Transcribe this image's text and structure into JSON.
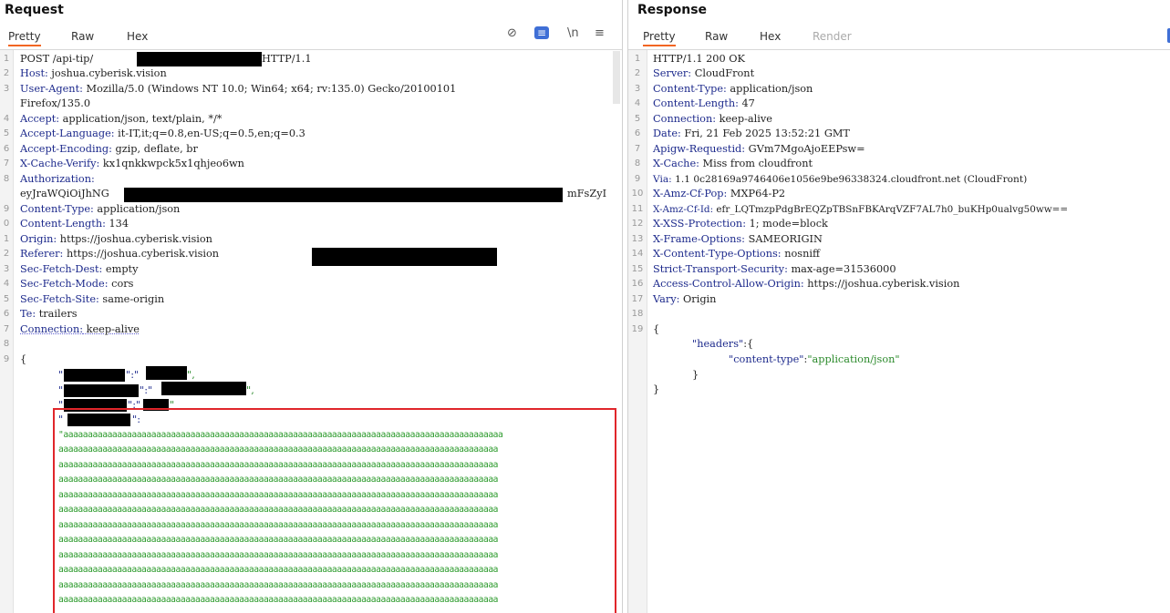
{
  "request": {
    "title": "Request",
    "tabs": [
      "Pretty",
      "Raw",
      "Hex"
    ],
    "toolbar_icons": [
      "eye-slash-icon",
      "wrap-icon",
      "newline-icon",
      "menu-icon"
    ],
    "toolbar_glyphs": [
      "⊘",
      "≡",
      "\\n",
      "≡"
    ],
    "lines": [
      {
        "n": "1",
        "text": "POST /api-tip/",
        "suffix": " HTTP/1.1"
      },
      {
        "n": "2",
        "key": "Host:",
        "value": " joshua.cyberisk.vision"
      },
      {
        "n": "3",
        "key": "User-Agent:",
        "value": " Mozilla/5.0 (Windows NT 10.0; Win64; x64; rv:135.0) Gecko/20100101"
      },
      {
        "n": "",
        "value": "Firefox/135.0"
      },
      {
        "n": "4",
        "key": "Accept:",
        "value": " application/json, text/plain, */*"
      },
      {
        "n": "5",
        "key": "Accept-Language:",
        "value": " it-IT,it;q=0.8,en-US;q=0.5,en;q=0.3"
      },
      {
        "n": "6",
        "key": "Accept-Encoding:",
        "value": " gzip, deflate, br"
      },
      {
        "n": "7",
        "key": "X-Cache-Verify:",
        "value": " kx1qnkkwpck5x1qhjeo6wn"
      },
      {
        "n": "8",
        "key": "Authorization:",
        "value": ""
      },
      {
        "n": "",
        "value": "eyJraWQiOiJhNG",
        "suffix": "mFsZyI"
      },
      {
        "n": "9",
        "key": "Content-Type:",
        "value": " application/json"
      },
      {
        "n": "0",
        "key": "Content-Length:",
        "value": " 134"
      },
      {
        "n": "1",
        "key": "Origin:",
        "value": " https://joshua.cyberisk.vision"
      },
      {
        "n": "2",
        "key": "Referer:",
        "value": " https://joshua.cyberisk.vision"
      },
      {
        "n": "3",
        "key": "Sec-Fetch-Dest:",
        "value": " empty"
      },
      {
        "n": "4",
        "key": "Sec-Fetch-Mode:",
        "value": " cors"
      },
      {
        "n": "5",
        "key": "Sec-Fetch-Site:",
        "value": " same-origin"
      },
      {
        "n": "6",
        "key": "Te:",
        "value": " trailers"
      },
      {
        "n": "7",
        "key": "Connection:",
        "value": " keep-alive"
      },
      {
        "n": "8",
        "value": ""
      },
      {
        "n": "9",
        "value": "{"
      }
    ],
    "body_fragments": {
      "row1_sep": "\":\"",
      "row1_end": "\",",
      "row2_sep": "\":\"",
      "row2_end": "\",",
      "row3_sep": "\":\"",
      "row3_end": "\"",
      "row4_open": "\"",
      "row4_end": "\":",
      "aa_open": "\"",
      "aa_line": "aaaaaaaaaaaaaaaaaaaaaaaaaaaaaaaaaaaaaaaaaaaaaaaaaaaaaaaaaaaaaaaaaaaaaaaaaaaaaaaaaaaaaaaaaa"
    }
  },
  "response": {
    "title": "Response",
    "tabs": [
      "Pretty",
      "Raw",
      "Hex",
      "Render"
    ],
    "lines": [
      {
        "n": "1",
        "value": "HTTP/1.1 200 OK"
      },
      {
        "n": "2",
        "key": "Server:",
        "value": " CloudFront"
      },
      {
        "n": "3",
        "key": "Content-Type:",
        "value": " application/json"
      },
      {
        "n": "4",
        "key": "Content-Length:",
        "value": " 47"
      },
      {
        "n": "5",
        "key": "Connection:",
        "value": " keep-alive"
      },
      {
        "n": "6",
        "key": "Date:",
        "value": " Fri, 21 Feb 2025 13:52:21 GMT"
      },
      {
        "n": "7",
        "key": "Apigw-Requestid:",
        "value": " GVm7MgoAjoEEPsw="
      },
      {
        "n": "8",
        "key": "X-Cache:",
        "value": " Miss from cloudfront"
      },
      {
        "n": "9",
        "key": "Via:",
        "value": " 1.1 0c28169a9746406e1056e9be96338324.cloudfront.net (CloudFront)"
      },
      {
        "n": "10",
        "key": "X-Amz-Cf-Pop:",
        "value": " MXP64-P2"
      },
      {
        "n": "11",
        "key": "X-Amz-Cf-Id:",
        "value": " efr_LQTmzpPdgBrEQZpTBSnFBKArqVZF7AL7h0_buKHp0ualvg50ww=="
      },
      {
        "n": "12",
        "key": "X-XSS-Protection:",
        "value": " 1; mode=block"
      },
      {
        "n": "13",
        "key": "X-Frame-Options:",
        "value": " SAMEORIGIN"
      },
      {
        "n": "14",
        "key": "X-Content-Type-Options:",
        "value": " nosniff"
      },
      {
        "n": "15",
        "key": "Strict-Transport-Security:",
        "value": " max-age=31536000"
      },
      {
        "n": "16",
        "key": "Access-Control-Allow-Origin:",
        "value": " https://joshua.cyberisk.vision"
      },
      {
        "n": "17",
        "key": "Vary:",
        "value": " Origin"
      },
      {
        "n": "18",
        "value": ""
      },
      {
        "n": "19",
        "value": "{"
      },
      {
        "n": "",
        "value": ""
      },
      {
        "n": "",
        "value": ""
      },
      {
        "n": "",
        "value": "}"
      },
      {
        "n": "",
        "value": "}"
      }
    ],
    "json_key_headers": "\"headers\"",
    "json_colon_brace": ":{",
    "json_key_ct": "\"content-type\"",
    "json_colon": ":",
    "json_val_ct": "\"application/json\""
  },
  "colors": {
    "accent": "#f26522",
    "redaction": "#000000",
    "highlight_box": "#e0262b",
    "header_key": "#1d2a8c",
    "json_string": "#2b8a2b"
  }
}
